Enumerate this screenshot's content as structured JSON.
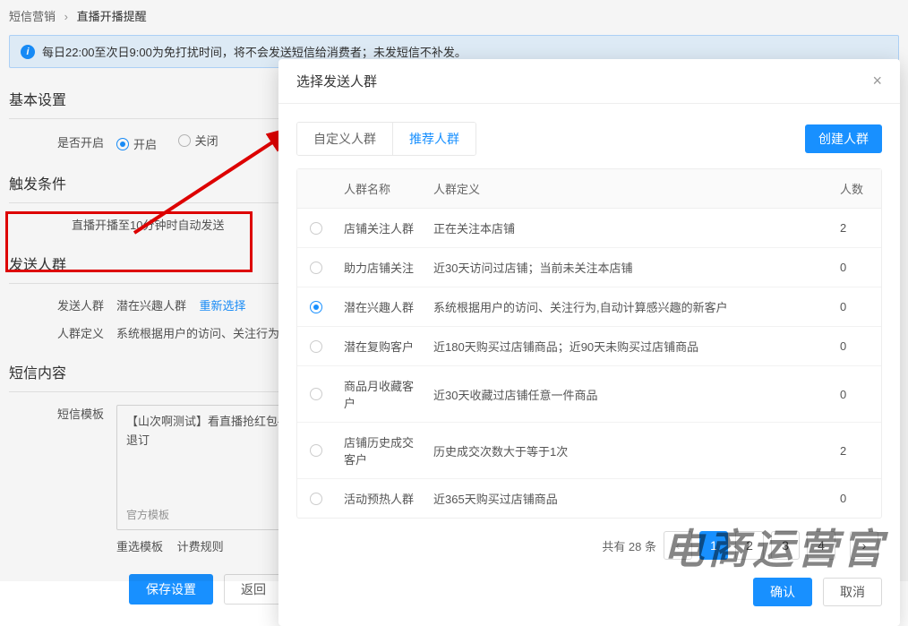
{
  "breadcrumb": {
    "parent": "短信营销",
    "current": "直播开播提醒"
  },
  "banner": "每日22:00至次日9:00为免打扰时间，将不会发送短信给消费者；未发短信不补发。",
  "sections": {
    "basic": "基本设置",
    "trigger": "触发条件",
    "audience": "发送人群",
    "content": "短信内容"
  },
  "form": {
    "enable_label": "是否开启",
    "enable_on": "开启",
    "enable_off": "关闭",
    "trigger_text": "直播开播至10分钟时自动发送",
    "audience_label": "发送人群",
    "audience_value": "潜在兴趣人群",
    "audience_reselect": "重新选择",
    "audience_def_label": "人群定义",
    "audience_def_value": "系统根据用户的访问、关注行为",
    "template_label": "短信模板",
    "template_text": "【山次啊测试】看直播抢红包{直播间链接} 回TD退订",
    "template_footer": "官方模板",
    "reselect_template": "重选模板",
    "billing_rules": "计费规则",
    "save": "保存设置",
    "back": "返回"
  },
  "modal": {
    "title": "选择发送人群",
    "tab_custom": "自定义人群",
    "tab_recommended": "推荐人群",
    "create": "创建人群",
    "cols": {
      "name": "人群名称",
      "def": "人群定义",
      "count": "人数"
    },
    "rows": [
      {
        "selected": false,
        "name": "店铺关注人群",
        "def": "正在关注本店铺",
        "count": "2"
      },
      {
        "selected": false,
        "name": "助力店铺关注",
        "def": "近30天访问过店铺；当前未关注本店铺",
        "count": "0"
      },
      {
        "selected": true,
        "name": "潜在兴趣人群",
        "def": "系统根据用户的访问、关注行为,自动计算感兴趣的新客户",
        "count": "0"
      },
      {
        "selected": false,
        "name": "潜在复购客户",
        "def": "近180天购买过店铺商品；近90天未购买过店铺商品",
        "count": "0"
      },
      {
        "selected": false,
        "name": "商品月收藏客户",
        "def": "近30天收藏过店铺任意一件商品",
        "count": "0"
      },
      {
        "selected": false,
        "name": "店铺历史成交客户",
        "def": "历史成交次数大于等于1次",
        "count": "2"
      },
      {
        "selected": false,
        "name": "活动预热人群",
        "def": "近365天购买过店铺商品",
        "count": "0"
      }
    ],
    "total": "共有 28 条",
    "pages": [
      "1",
      "2",
      "3",
      "4"
    ],
    "confirm": "确认",
    "cancel": "取消"
  },
  "watermark": "电商运营官"
}
